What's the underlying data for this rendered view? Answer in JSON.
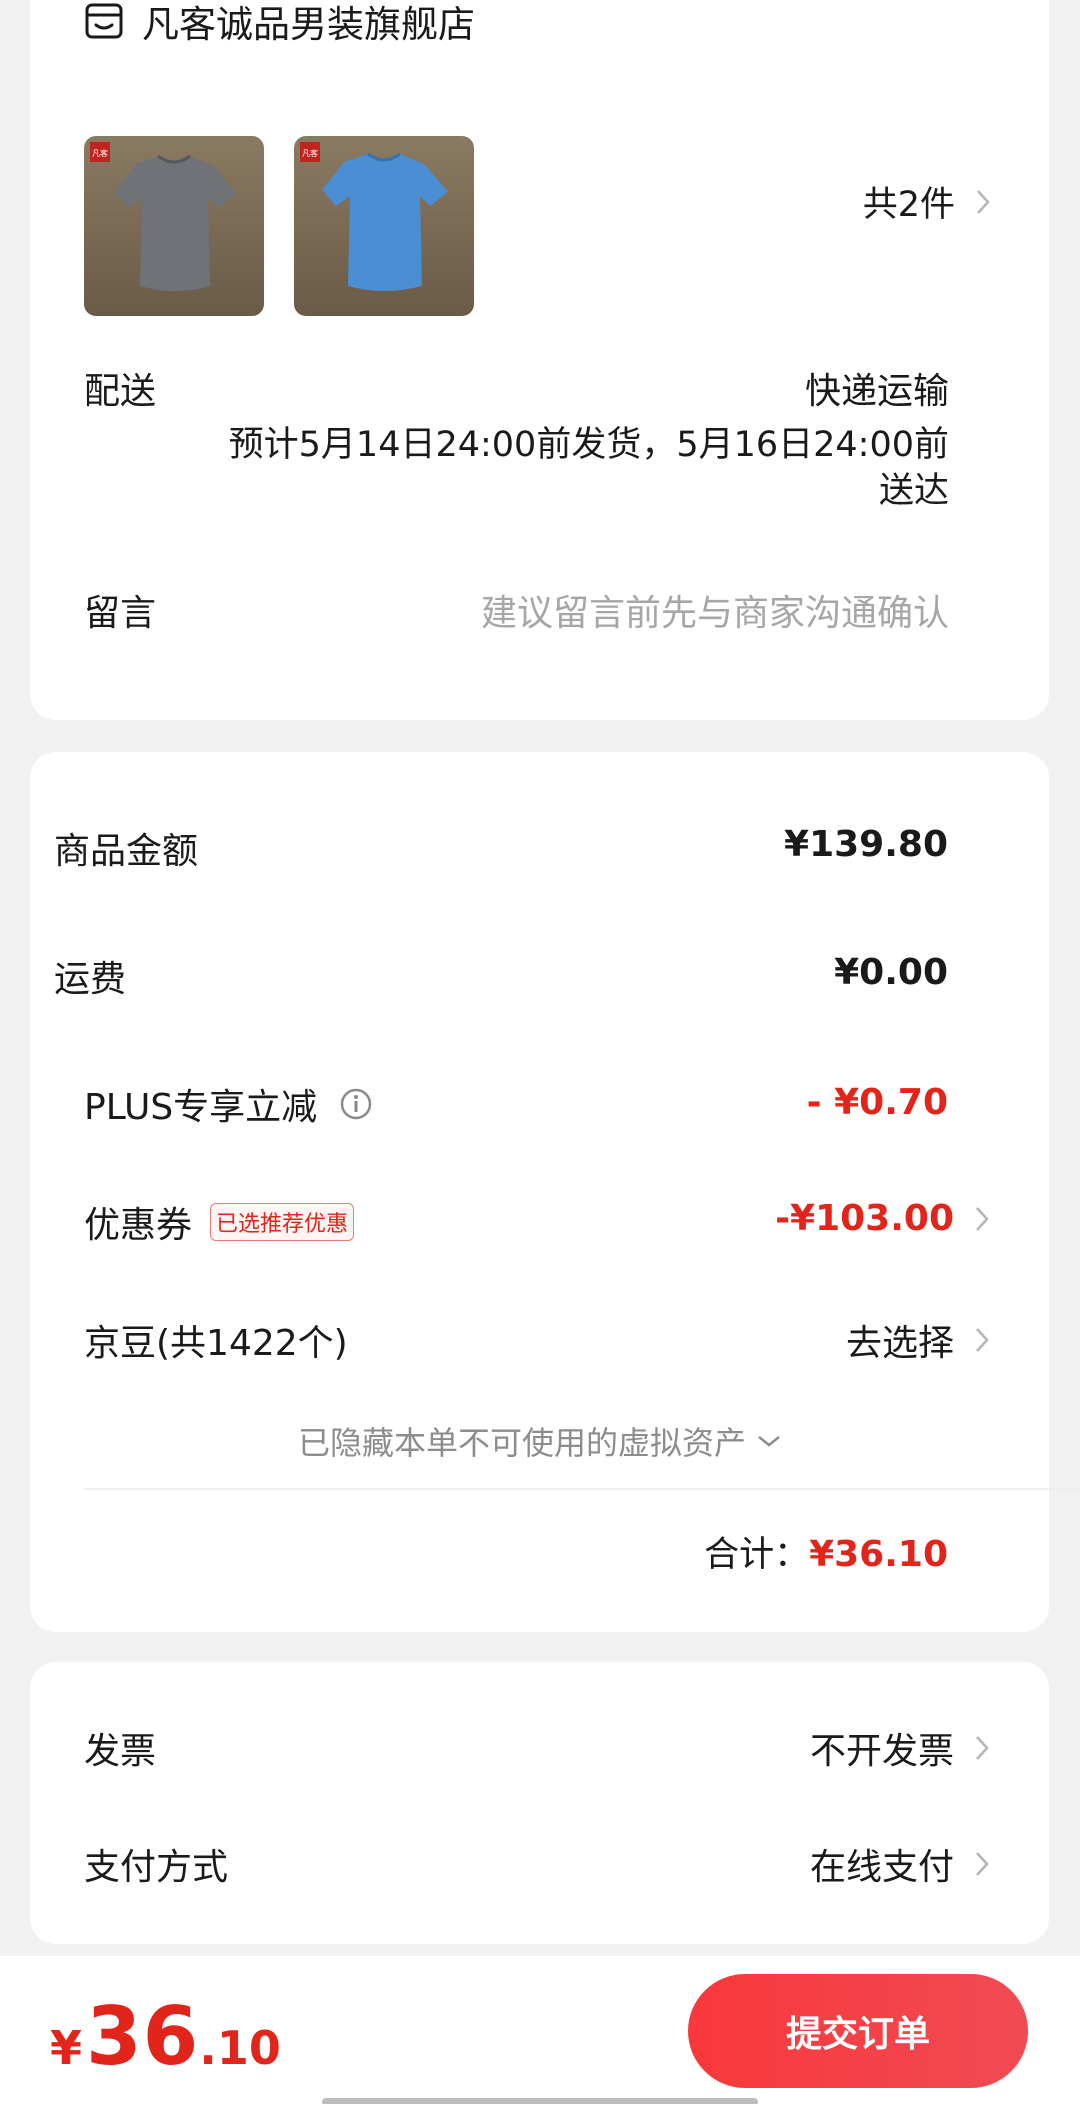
{
  "store": {
    "name": "凡客诚品男装旗舰店",
    "icon": "store-icon"
  },
  "items": {
    "thumbs": [
      {
        "color": "#6f7378",
        "name": "grey-tshirt"
      },
      {
        "color": "#4a8fd4",
        "name": "blue-tshirt"
      }
    ],
    "count_label": "共2件"
  },
  "delivery": {
    "label": "配送",
    "method": "快递运输",
    "estimate_line1": "预计5月14日24:00前发货，5月16日24:00前",
    "estimate_line2": "送达"
  },
  "message": {
    "label": "留言",
    "placeholder": "建议留言前先与商家沟通确认"
  },
  "pricing": {
    "goods_label": "商品金额",
    "goods_value": "¥139.80",
    "shipping_label": "运费",
    "shipping_value": "¥0.00",
    "plus_label": "PLUS专享立减",
    "plus_value": "- ¥0.70",
    "coupon_label": "优惠券",
    "coupon_badge": "已选推荐优惠",
    "coupon_value": "-¥103.00",
    "jingdou_label": "京豆(共1422个)",
    "jingdou_action": "去选择",
    "hidden_assets": "已隐藏本单不可使用的虚拟资产",
    "total_label": "合计：",
    "total_value": "¥36.10"
  },
  "invoice": {
    "label": "发票",
    "value": "不开发票"
  },
  "payment": {
    "label": "支付方式",
    "value": "在线支付"
  },
  "bottom": {
    "currency": "¥",
    "amount_int": "36",
    "amount_dec": ".10",
    "submit_label": "提交订单"
  },
  "colors": {
    "accent": "#e1251b",
    "background": "#f1f1f1"
  }
}
